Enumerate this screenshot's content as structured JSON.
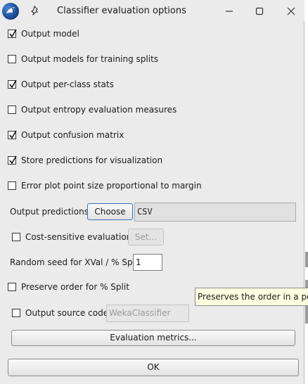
{
  "window": {
    "title": "Classifier evaluation options",
    "icons": [
      "weka-bird-icon",
      "pin-icon",
      "minimize-icon",
      "maximize-icon",
      "close-icon"
    ]
  },
  "checkboxes": [
    {
      "label": "Output model",
      "checked": true
    },
    {
      "label": "Output models for training splits",
      "checked": false
    },
    {
      "label": "Output per-class stats",
      "checked": true
    },
    {
      "label": "Output entropy evaluation measures",
      "checked": false
    },
    {
      "label": "Output confusion matrix",
      "checked": true
    },
    {
      "label": "Store predictions for visualization",
      "checked": true
    },
    {
      "label": "Error plot point size proportional to margin",
      "checked": false
    }
  ],
  "output_predictions": {
    "label": "Output predictions",
    "button_label": "Choose",
    "value": "CSV"
  },
  "cost_sensitive": {
    "label": "Cost-sensitive evaluation",
    "checked": false,
    "button_label": "Set..."
  },
  "random_seed": {
    "label": "Random seed for XVal / % Split",
    "value": "1"
  },
  "preserve_order": {
    "label": "Preserve order for % Split",
    "checked": false
  },
  "tooltip": {
    "text": "Preserves the order in a percentage split"
  },
  "output_source": {
    "label": "Output source code",
    "checked": false,
    "value": "WekaClassifier"
  },
  "buttons": {
    "evaluation_metrics": "Evaluation metrics...",
    "ok": "OK"
  },
  "colors": {
    "dialog_bg": "#ebebeb",
    "tooltip_bg": "#ffffe1"
  }
}
